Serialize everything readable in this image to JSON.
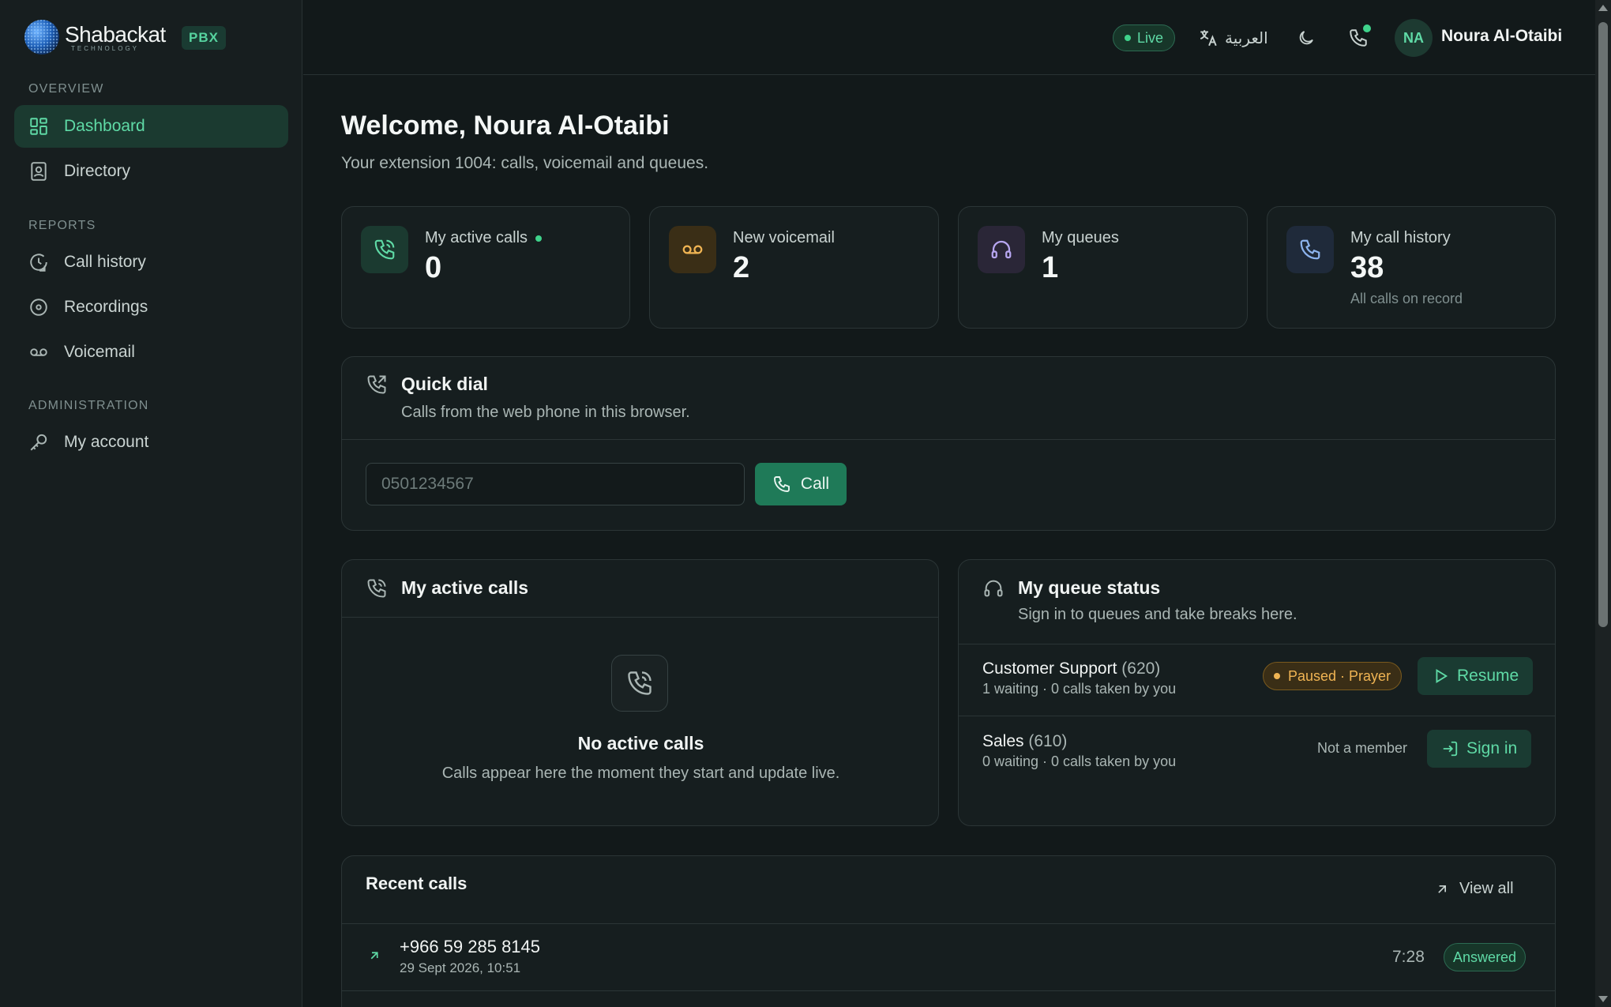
{
  "brand": {
    "name": "Shabackat",
    "tagline": "TECHNOLOGY",
    "badge": "PBX"
  },
  "sidebar": {
    "sections": [
      {
        "label": "OVERVIEW"
      },
      {
        "label": "REPORTS"
      },
      {
        "label": "ADMINISTRATION"
      }
    ],
    "items": [
      {
        "label": "Dashboard",
        "icon": "grid-icon",
        "active": true
      },
      {
        "label": "Directory",
        "icon": "contact-book-icon"
      },
      {
        "label": "Call history",
        "icon": "clock-history-icon"
      },
      {
        "label": "Recordings",
        "icon": "record-icon"
      },
      {
        "label": "Voicemail",
        "icon": "voicemail-icon"
      },
      {
        "label": "My account",
        "icon": "key-icon"
      }
    ]
  },
  "header": {
    "live_label": "Live",
    "language_label": "العربية",
    "user_initials": "NA",
    "user_name": "Noura Al-Otaibi"
  },
  "welcome": {
    "title": "Welcome, Noura Al-Otaibi",
    "subtitle": "Your extension 1004: calls, voicemail and queues."
  },
  "stats": [
    {
      "label": "My active calls",
      "value": "0",
      "icon": "phone-call-icon",
      "live": true
    },
    {
      "label": "New voicemail",
      "value": "2",
      "icon": "voicemail-icon"
    },
    {
      "label": "My queues",
      "value": "1",
      "icon": "headphones-icon"
    },
    {
      "label": "My call history",
      "value": "38",
      "note": "All calls on record",
      "icon": "phone-icon"
    }
  ],
  "quick_dial": {
    "title": "Quick dial",
    "subtitle": "Calls from the web phone in this browser.",
    "placeholder": "0501234567",
    "call_label": "Call"
  },
  "active_calls": {
    "title": "My active calls",
    "empty_title": "No active calls",
    "empty_sub": "Calls appear here the moment they start and update live."
  },
  "queue_status": {
    "title": "My queue status",
    "subtitle": "Sign in to queues and take breaks here.",
    "queues": [
      {
        "name": "Customer Support",
        "number": "(620)",
        "meta": "1 waiting · 0 calls taken by you",
        "status": "Paused · Prayer",
        "action": "Resume"
      },
      {
        "name": "Sales",
        "number": "(610)",
        "meta": "0 waiting · 0 calls taken by you",
        "status": "Not a member",
        "action": "Sign in"
      }
    ]
  },
  "recent_calls": {
    "title": "Recent calls",
    "view_all": "View all",
    "rows": [
      {
        "number": "+966 59 285 8145",
        "time": "29 Sept 2026, 10:51",
        "duration": "7:28",
        "status": "Answered"
      }
    ]
  },
  "colors": {
    "accent": "#5fdaa6",
    "background": "#12191a",
    "paused": "#f0b453"
  }
}
